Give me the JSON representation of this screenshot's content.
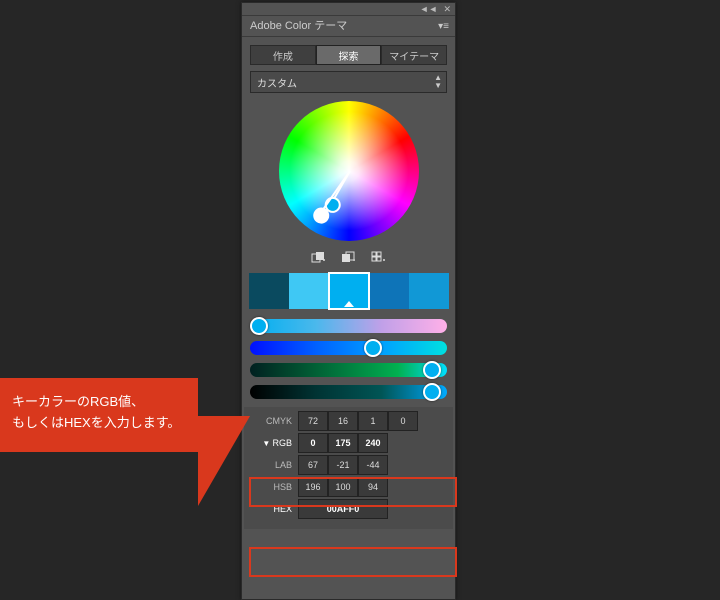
{
  "panel": {
    "title": "Adobe Color テーマ",
    "tabs": {
      "create": "作成",
      "explore": "探索",
      "myThemes": "マイテーマ",
      "active": "探索"
    },
    "ruleDropdown": {
      "selected": "カスタム"
    },
    "swatches": [
      {
        "hex": "#0A4A5F"
      },
      {
        "hex": "#3FC8F4"
      },
      {
        "hex": "#00AFF0",
        "selected": true
      },
      {
        "hex": "#0E74B8"
      },
      {
        "hex": "#1198D6"
      }
    ],
    "values": {
      "cmyk": {
        "label": "CMYK",
        "c": "72",
        "m": "16",
        "y": "1",
        "k": "0"
      },
      "rgb": {
        "label": "RGB",
        "r": "0",
        "g": "175",
        "b": "240"
      },
      "lab": {
        "label": "LAB",
        "l": "67",
        "a": "-21",
        "b": "-44"
      },
      "hsb": {
        "label": "HSB",
        "h": "196",
        "s": "100",
        "b": "94"
      },
      "hex": {
        "label": "HEX",
        "value": "00AFF0"
      }
    }
  },
  "callout": {
    "line1": "キーカラーのRGB値、",
    "line2": "もしくはHEXを入力します。"
  }
}
